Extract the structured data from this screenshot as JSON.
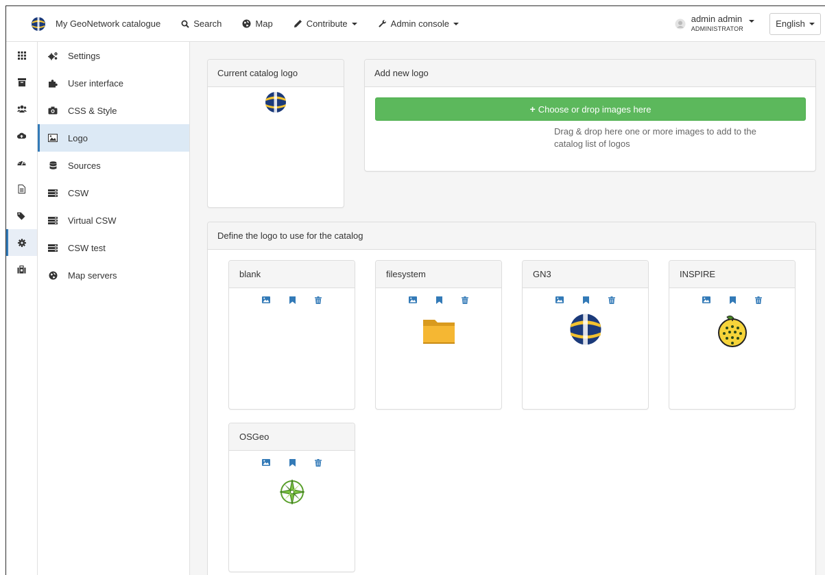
{
  "navbar": {
    "brand": "My GeoNetwork catalogue",
    "search": "Search",
    "map": "Map",
    "contribute": "Contribute",
    "admin_console": "Admin console",
    "user_name": "admin admin",
    "user_role": "ADMINISTRATOR",
    "language": "English"
  },
  "rail": {
    "items": [
      {
        "icon": "dashboard-grid-icon"
      },
      {
        "icon": "archive-icon"
      },
      {
        "icon": "users-icon"
      },
      {
        "icon": "cloud-upload-icon"
      },
      {
        "icon": "dashboard-gauge-icon"
      },
      {
        "icon": "file-icon"
      },
      {
        "icon": "tags-icon"
      },
      {
        "icon": "gear-icon"
      },
      {
        "icon": "toolbox-icon"
      }
    ],
    "active_index": 7
  },
  "submenu": {
    "items": [
      {
        "label": "Settings",
        "icon": "cogs-icon"
      },
      {
        "label": "User interface",
        "icon": "puzzle-icon"
      },
      {
        "label": "CSS & Style",
        "icon": "camera-icon"
      },
      {
        "label": "Logo",
        "icon": "picture-icon"
      },
      {
        "label": "Sources",
        "icon": "database-icon"
      },
      {
        "label": "CSW",
        "icon": "server-icon"
      },
      {
        "label": "Virtual CSW",
        "icon": "server-icon"
      },
      {
        "label": "CSW test",
        "icon": "server-icon"
      },
      {
        "label": "Map servers",
        "icon": "globe-icon"
      }
    ],
    "active_index": 3
  },
  "current_logo": {
    "title": "Current catalog logo"
  },
  "add_logo": {
    "title": "Add new logo",
    "button": "Choose or drop images here",
    "help": "Drag & drop here one or more images to add to the catalog list of logos"
  },
  "define_logo": {
    "title": "Define the logo to use for the catalog",
    "logos": [
      {
        "name": "blank",
        "image": "none"
      },
      {
        "name": "filesystem",
        "image": "folder-icon"
      },
      {
        "name": "GN3",
        "image": "geonetwork-globe"
      },
      {
        "name": "INSPIRE",
        "image": "inspire-globe"
      },
      {
        "name": "OSGeo",
        "image": "osgeo-compass"
      }
    ]
  },
  "colors": {
    "accent": "#337ab7",
    "success": "#5cb85c",
    "active_bg": "#dce9f5",
    "panel_heading": "#f5f5f5"
  }
}
